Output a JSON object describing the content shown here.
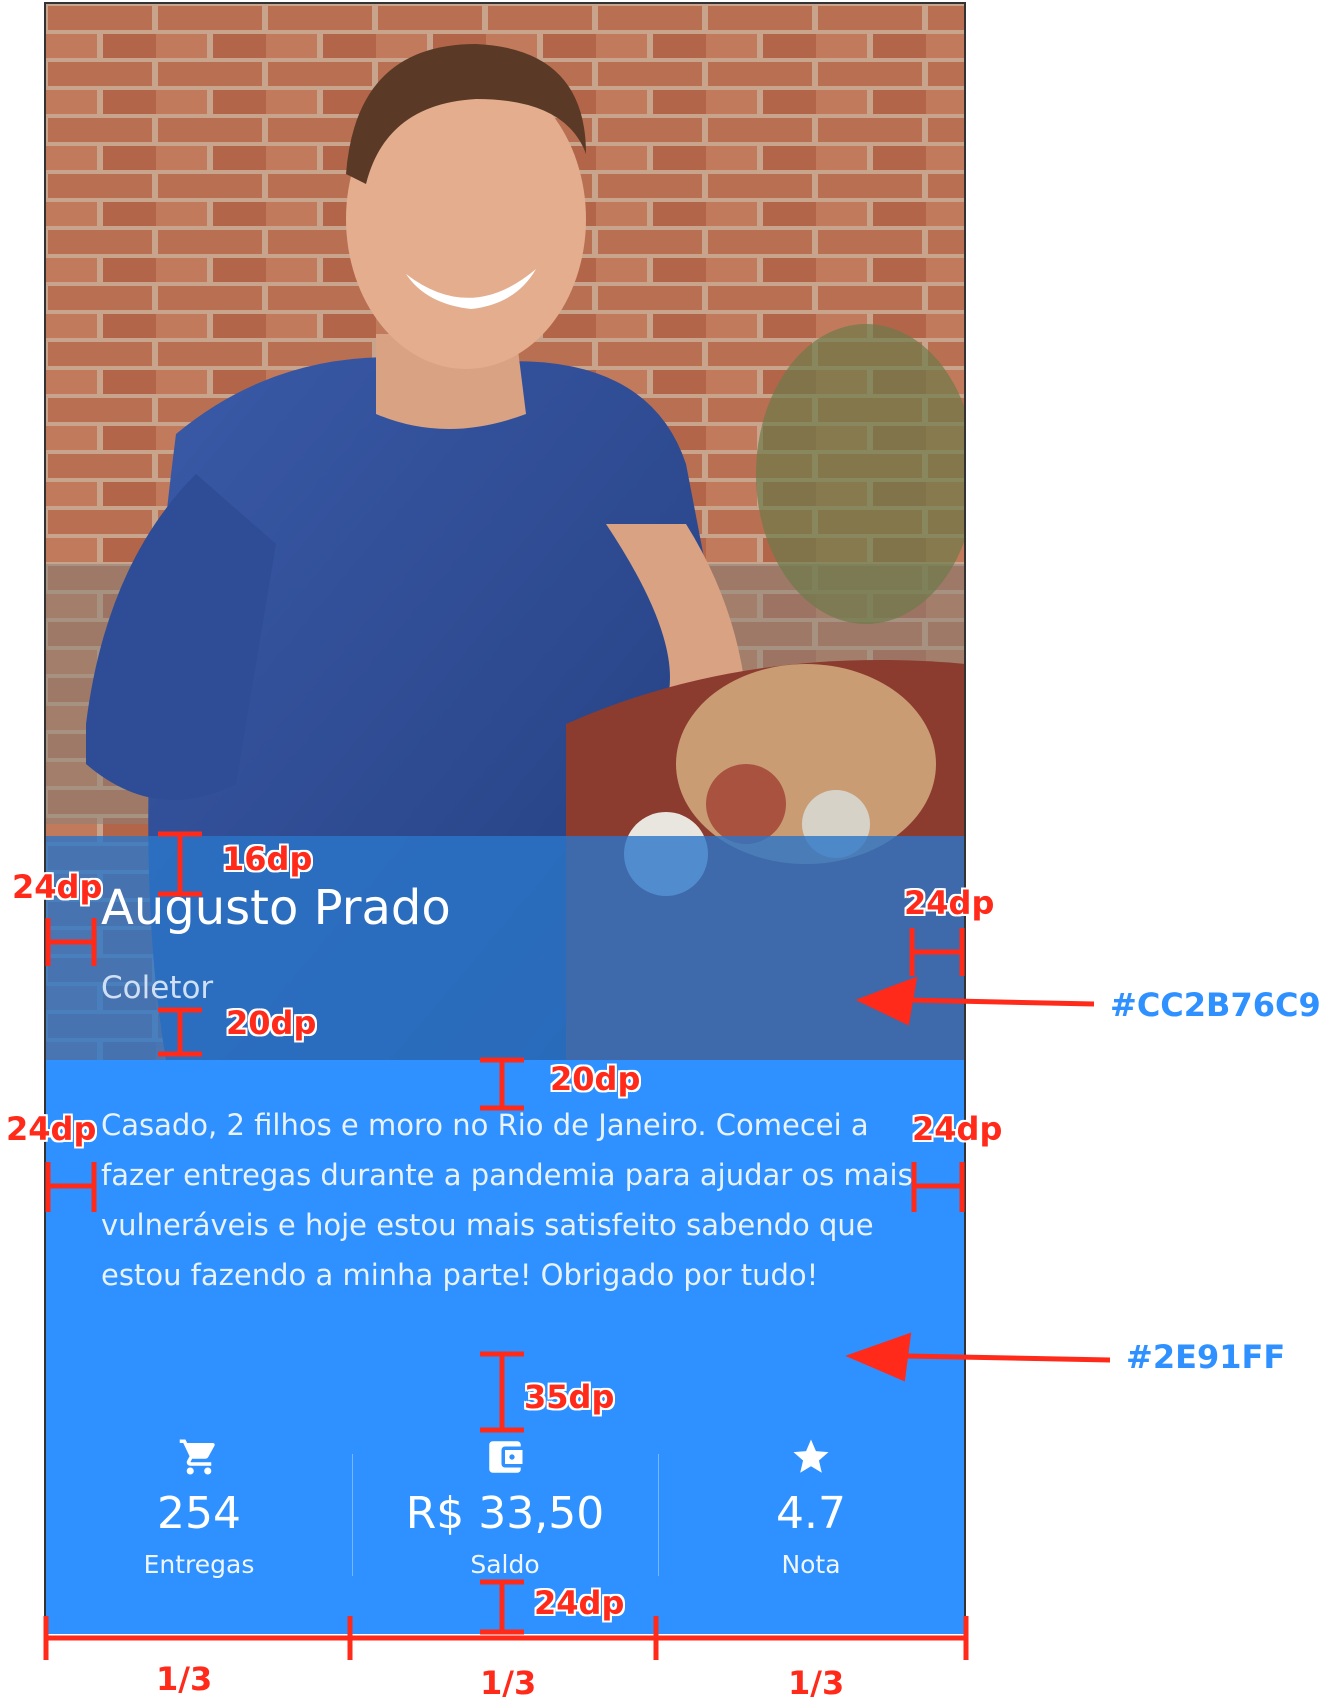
{
  "profile": {
    "name": "Augusto Prado",
    "role": "Coletor",
    "bio": "Casado, 2 filhos e moro no Rio de Janeiro. Comecei a fazer entregas durante a pandemia para ajudar os mais vulneráveis e hoje estou mais satisfeito sabendo que estou fazendo a minha parte! Obrigado por tudo!"
  },
  "stats": [
    {
      "icon": "shopping-cart-icon",
      "value": "254",
      "label": "Entregas"
    },
    {
      "icon": "wallet-icon",
      "value": "R$ 33,50",
      "label": "Saldo"
    },
    {
      "icon": "star-icon",
      "value": "4.7",
      "label": "Nota"
    }
  ],
  "colors": {
    "overlay": "#CC2B76C9",
    "background": "#2E91FF",
    "annotation": "#ff2a1a"
  },
  "annotations": {
    "name_top": "16dp",
    "name_left": "24dp",
    "name_right": "24dp",
    "role_bottom": "20dp",
    "bio_top": "20dp",
    "bio_left": "24dp",
    "bio_right": "24dp",
    "stats_top": "35dp",
    "stats_bottom": "24dp",
    "overlay_color": "#CC2B76C9",
    "background_color": "#2E91FF",
    "third_1": "1/3",
    "third_2": "1/3",
    "third_3": "1/3"
  }
}
